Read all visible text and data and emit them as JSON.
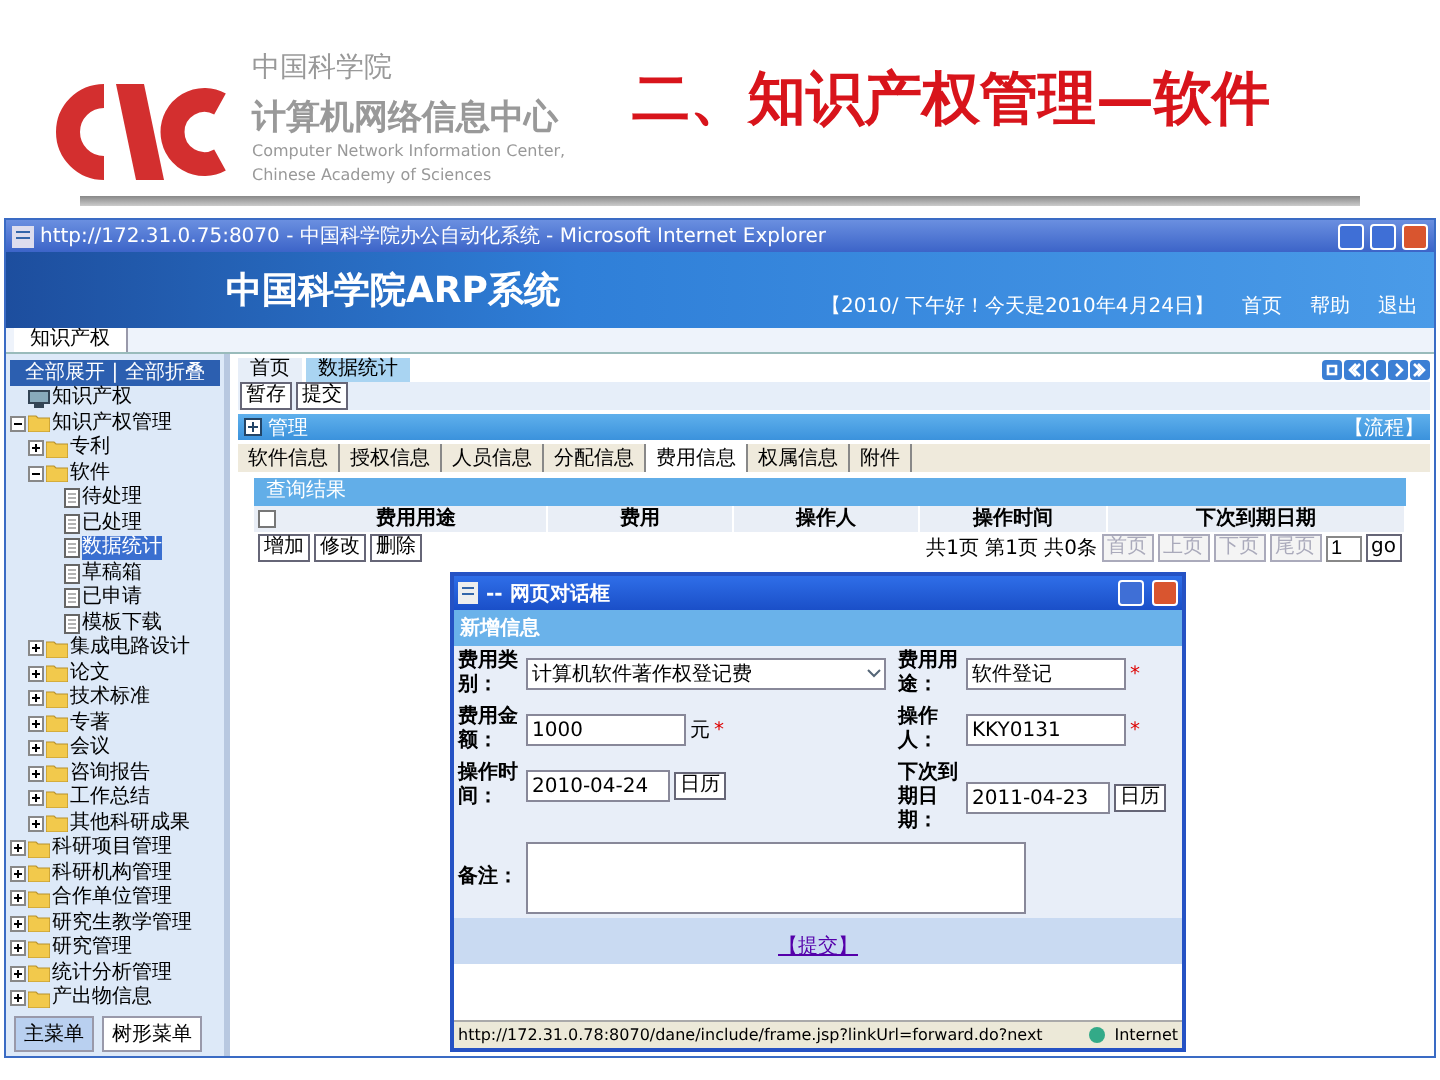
{
  "slide_header": {
    "org_cn": "中国科学院",
    "center_cn": "计算机网络信息中心",
    "center_en": [
      "Computer Network Information Center,",
      "Chinese Academy of Sciences"
    ],
    "title": "二、知识产权管理—软件"
  },
  "window": {
    "title": "http://172.31.0.75:8070 - 中国科学院办公自动化系统 - Microsoft Internet Explorer"
  },
  "banner": {
    "title": "中国科学院ARP系统",
    "greeting": "【2010/ 下午好！今天是2010年4月24日】",
    "links": [
      "首页",
      "帮助",
      "退出"
    ]
  },
  "module_tabs": [
    {
      "label": "知识产权",
      "selected": true
    }
  ],
  "sidebar": {
    "header": "全部展开 | 全部折叠",
    "tree": [
      {
        "label": "知识产权",
        "kind": "root",
        "selected": false
      },
      {
        "label": "知识产权管理",
        "kind": "folder",
        "expanded": true,
        "selected": false,
        "children": [
          {
            "label": "专利",
            "kind": "folder",
            "expanded": false,
            "selected": false
          },
          {
            "label": "软件",
            "kind": "folder",
            "expanded": true,
            "selected": false,
            "children": [
              {
                "label": "待处理",
                "kind": "doc",
                "selected": false
              },
              {
                "label": "已处理",
                "kind": "doc",
                "selected": false
              },
              {
                "label": "数据统计",
                "kind": "doc",
                "selected": true
              },
              {
                "label": "草稿箱",
                "kind": "doc",
                "selected": false
              },
              {
                "label": "已申请",
                "kind": "doc",
                "selected": false
              },
              {
                "label": "模板下载",
                "kind": "doc",
                "selected": false
              }
            ]
          },
          {
            "label": "集成电路设计",
            "kind": "folder",
            "expanded": false,
            "selected": false
          },
          {
            "label": "论文",
            "kind": "folder",
            "expanded": false,
            "selected": false
          },
          {
            "label": "技术标准",
            "kind": "folder",
            "expanded": false,
            "selected": false
          },
          {
            "label": "专著",
            "kind": "folder",
            "expanded": false,
            "selected": false
          },
          {
            "label": "会议",
            "kind": "folder",
            "expanded": false,
            "selected": false
          },
          {
            "label": "咨询报告",
            "kind": "folder",
            "expanded": false,
            "selected": false
          },
          {
            "label": "工作总结",
            "kind": "folder",
            "expanded": false,
            "selected": false
          },
          {
            "label": "其他科研成果",
            "kind": "folder",
            "expanded": false,
            "selected": false
          }
        ]
      },
      {
        "label": "科研项目管理",
        "kind": "folder",
        "expanded": false,
        "selected": false
      },
      {
        "label": "科研机构管理",
        "kind": "folder",
        "expanded": false,
        "selected": false
      },
      {
        "label": "合作单位管理",
        "kind": "folder",
        "expanded": false,
        "selected": false
      },
      {
        "label": "研究生教学管理",
        "kind": "folder",
        "expanded": false,
        "selected": false
      },
      {
        "label": "研究管理",
        "kind": "folder",
        "expanded": false,
        "selected": false
      },
      {
        "label": "统计分析管理",
        "kind": "folder",
        "expanded": false,
        "selected": false
      },
      {
        "label": "产出物信息",
        "kind": "folder",
        "expanded": false,
        "selected": false
      }
    ],
    "bottom_tabs": [
      {
        "label": "主菜单",
        "selected": true
      },
      {
        "label": "树形菜单",
        "selected": false
      }
    ]
  },
  "main": {
    "page_tabs": [
      {
        "label": "首页",
        "selected": false
      },
      {
        "label": "数据统计",
        "selected": true
      }
    ],
    "actions": [
      "暂存",
      "提交"
    ],
    "section": {
      "title": "管理",
      "flow_link": "【流程】"
    },
    "sub_tabs": [
      {
        "label": "软件信息",
        "selected": false
      },
      {
        "label": "授权信息",
        "selected": false
      },
      {
        "label": "人员信息",
        "selected": false
      },
      {
        "label": "分配信息",
        "selected": false
      },
      {
        "label": "费用信息",
        "selected": true
      },
      {
        "label": "权属信息",
        "selected": false
      },
      {
        "label": "附件",
        "selected": false
      }
    ],
    "results": {
      "title": "查询结果",
      "select_all": {
        "checked": false
      },
      "columns": [
        "费用用途",
        "费用",
        "操作人",
        "操作时间",
        "下次到期日期"
      ],
      "row_buttons": [
        "增加",
        "修改",
        "删除"
      ],
      "pager": {
        "summary": "共1页 第1页 共0条",
        "buttons": [
          {
            "label": "首页",
            "disabled": true
          },
          {
            "label": "上页",
            "disabled": true
          },
          {
            "label": "下页",
            "disabled": true
          },
          {
            "label": "尾页",
            "disabled": true
          }
        ],
        "page": "1",
        "go": "go"
      }
    }
  },
  "dialog": {
    "title": "-- 网页对话框",
    "header": "新增信息",
    "fields": [
      {
        "kind": "select",
        "label": "费用类别：",
        "value": "计算机软件著作权登记费"
      },
      {
        "kind": "text",
        "label": "费用用途：",
        "value": "软件登记",
        "mark": "*"
      },
      {
        "kind": "text",
        "label": "费用金额：",
        "value": "1000",
        "suffix": "元",
        "mark": "*"
      },
      {
        "kind": "text",
        "label": "操作人：",
        "value": "KKY0131",
        "mark": "*"
      },
      {
        "kind": "date",
        "label": "操作时间：",
        "value": "2010-04-24",
        "button": "日历"
      },
      {
        "kind": "date",
        "label": "下次到期日期：",
        "value": "2011-04-23",
        "button": "日历"
      },
      {
        "kind": "textarea",
        "label": "备注："
      }
    ],
    "submit": "【提交】",
    "status": {
      "url": "http://172.31.0.78:8070/dane/include/frame.jsp?linkUrl=forward.do?next",
      "zone": "Internet"
    }
  }
}
